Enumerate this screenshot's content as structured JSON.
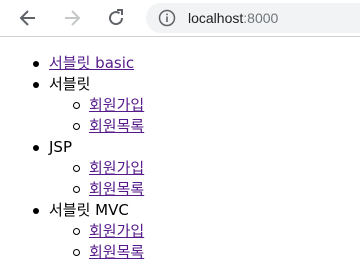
{
  "browser": {
    "url_host": "localhost",
    "url_port": ":8000"
  },
  "menu": {
    "top_link": "서블릿 basic",
    "groups": [
      {
        "title": "서블릿",
        "items": [
          "회원가입",
          "회원목록"
        ]
      },
      {
        "title": "JSP",
        "items": [
          "회원가입",
          "회원목록"
        ]
      },
      {
        "title": "서블릿 MVC",
        "items": [
          "회원가입",
          "회원목록"
        ]
      }
    ]
  },
  "colors": {
    "visited_link": "#551a8b",
    "omnibox_bg": "#f1f3f4"
  }
}
